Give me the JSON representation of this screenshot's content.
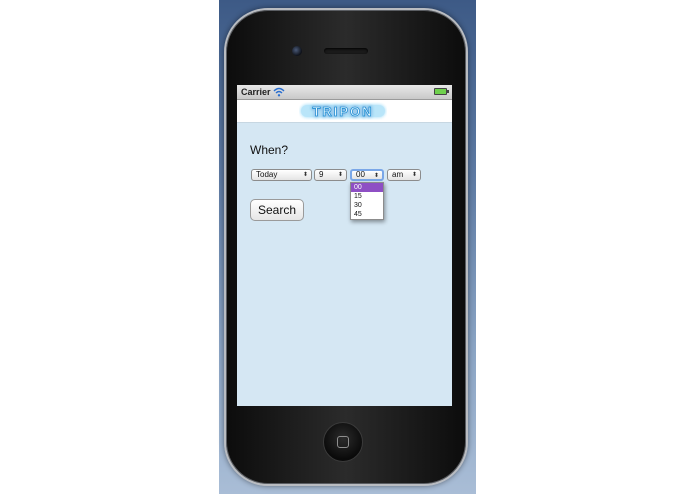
{
  "status_bar": {
    "carrier": "Carrier"
  },
  "app": {
    "logo_text": "TRIPON",
    "when_label": "When?",
    "day_select": {
      "value": "Today"
    },
    "hour_select": {
      "value": "9"
    },
    "minute_select": {
      "value": "00",
      "options": [
        "00",
        "15",
        "30",
        "45"
      ]
    },
    "ampm_select": {
      "value": "am"
    },
    "search_label": "Search"
  },
  "colors": {
    "screen_background": "#d5e7f3",
    "dropdown_highlight": "#8e4fc4",
    "logo_glow": "#37b6f0"
  },
  "icons": {
    "wifi": "wifi-icon",
    "battery": "battery-icon",
    "select_arrows": "updown-arrows-icon"
  }
}
